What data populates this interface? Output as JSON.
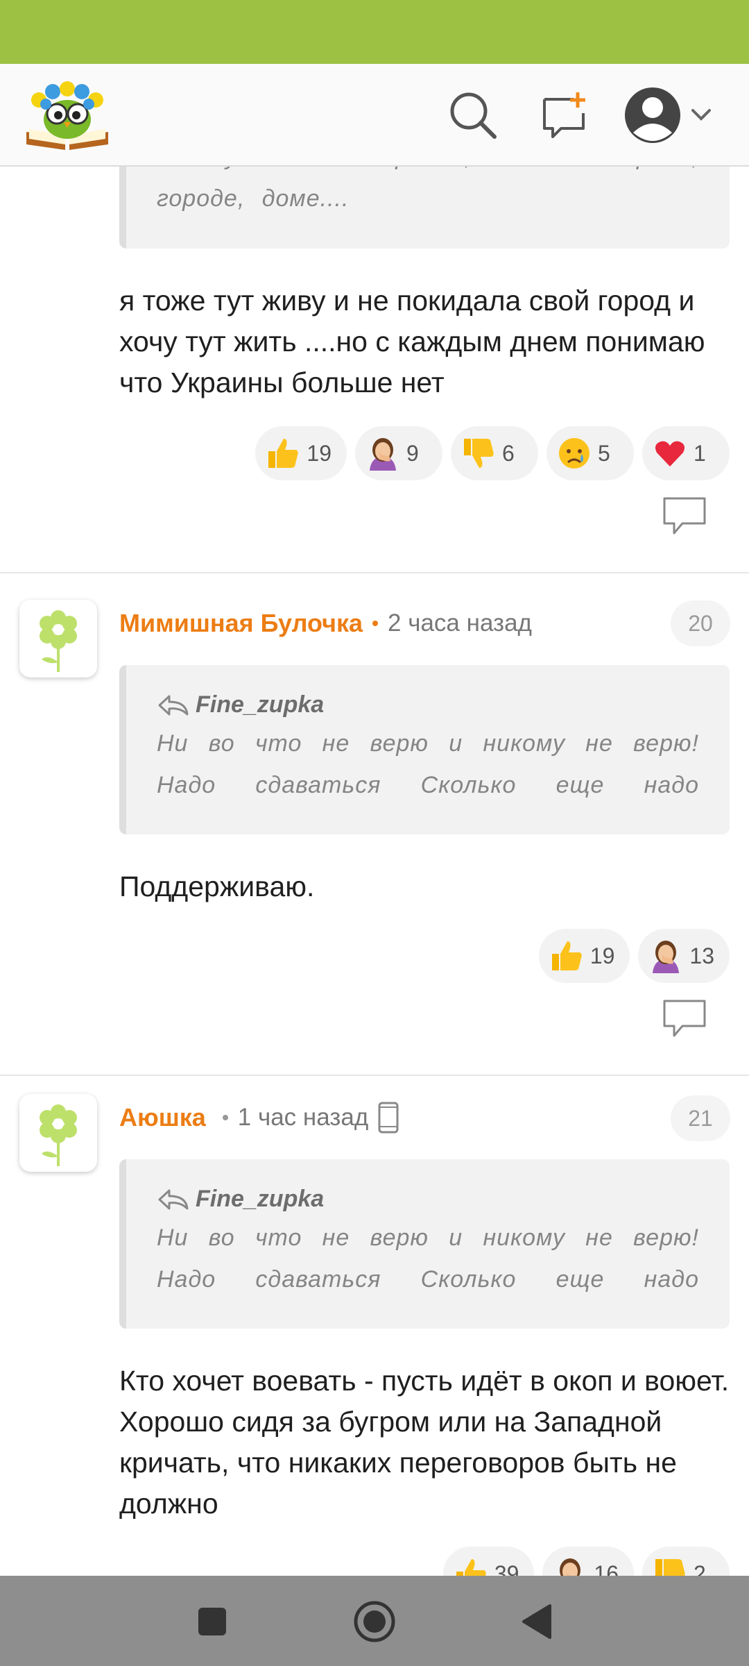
{
  "colors": {
    "status_bar": "#9dc143",
    "author": "#ec7d14",
    "nav_bar": "#8e8e8e"
  },
  "header": {
    "logo": "owl-on-book-logo",
    "icons": [
      "search-icon",
      "new-post-icon",
      "profile-avatar-icon",
      "chevron-down-icon"
    ]
  },
  "comments": [
    {
      "quote": {
        "text": "я хочу жить в Украине, в своей стране, городе, доме...."
      },
      "text": "я тоже тут живу и не покидала свой город и хочу тут жить ....но с каждым днем понимаю что Украины больше нет",
      "reactions": [
        {
          "emoji": "thumbs-up",
          "count": "19"
        },
        {
          "emoji": "facepalm",
          "count": "9"
        },
        {
          "emoji": "thumbs-down",
          "count": "6"
        },
        {
          "emoji": "crying",
          "count": "5"
        },
        {
          "emoji": "heart",
          "count": "1"
        }
      ]
    },
    {
      "author": "Мимишная Булочка",
      "time": "2 часа назад",
      "number": "20",
      "quote": {
        "author": "Fine_zupka",
        "text": "Ни во что не верю и никому не верю! Надо сдаваться Сколько еще надо жертв? Э..."
      },
      "text": "Поддерживаю.",
      "reactions": [
        {
          "emoji": "thumbs-up",
          "count": "19"
        },
        {
          "emoji": "facepalm",
          "count": "13"
        }
      ]
    },
    {
      "author": "Аюшка",
      "time": "1 час назад",
      "number": "21",
      "device": "mobile-phone-icon",
      "quote": {
        "author": "Fine_zupka",
        "text": "Ни во что не верю и никому не верю! Надо сдаваться Сколько еще надо жертв? Э..."
      },
      "text": "Кто хочет воевать - пусть идёт в окоп и воюет. Хорошо сидя за бугром или на Западной кричать, что никаких переговоров быть не должно",
      "reactions": [
        {
          "emoji": "thumbs-up",
          "count": "39"
        },
        {
          "emoji": "facepalm",
          "count": "16"
        },
        {
          "emoji": "thumbs-down",
          "count": "2"
        }
      ]
    }
  ],
  "nav": {
    "icons": [
      "recents-square-icon",
      "home-circle-icon",
      "back-triangle-icon"
    ]
  }
}
